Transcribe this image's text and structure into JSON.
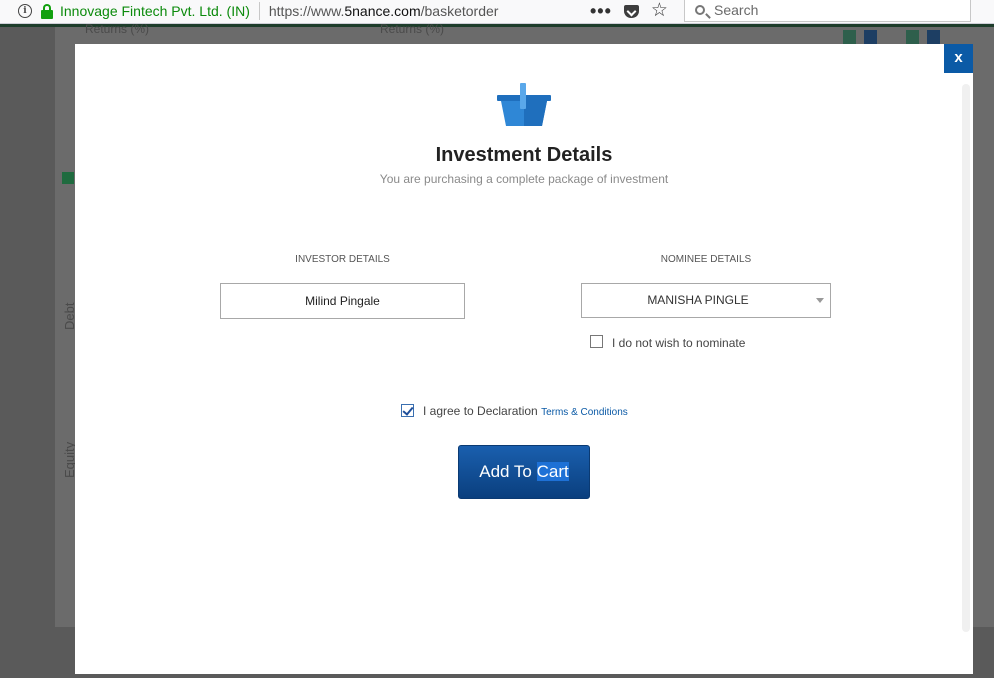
{
  "browser": {
    "site_identity": "Innovage Fintech Pvt. Ltd. (IN)",
    "url_prefix": "https://www.",
    "url_domain": "5nance.com",
    "url_path": "/basketorder",
    "page_actions_label": "•••",
    "search_placeholder": "Search"
  },
  "background_page": {
    "returns_label_1": "Returns (%)",
    "returns_label_2": "Returns (%)",
    "side_label_1": "Debt",
    "side_label_2": "Equity"
  },
  "modal": {
    "close_label": "x",
    "title": "Investment Details",
    "subtitle": "You are purchasing a complete package of investment",
    "investor": {
      "section_label": "INVESTOR DETAILS",
      "name": "Milind Pingale"
    },
    "nominee": {
      "section_label": "NOMINEE DETAILS",
      "selected": "MANISHA PINGLE",
      "no_nominate_label": "I do not wish to nominate",
      "no_nominate_checked": false
    },
    "declaration": {
      "label": "I agree to Declaration",
      "link_text": "Terms & Conditions",
      "checked": true
    },
    "cart_button": {
      "label_part1": "Add To ",
      "label_part2": "Cart"
    }
  },
  "colors": {
    "primary": "#0b5aa6",
    "secure_green": "#0b8a0b",
    "basket_blue": "#2f87d6"
  }
}
